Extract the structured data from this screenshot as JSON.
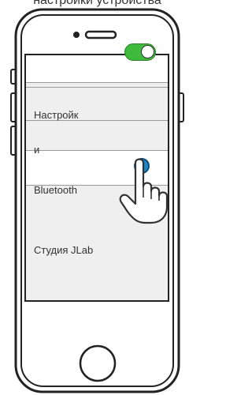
{
  "caption": {
    "text": "настройки устройства"
  },
  "settings": {
    "label_line1": "Настройк",
    "label_line2": "и",
    "bluetooth_label": "Bluetooth",
    "studio_label": "Студия JLab",
    "toggle_state": "on"
  },
  "colors": {
    "toggle_on": "#3fba3c",
    "touch_dot": "#1a88c8"
  },
  "icons": {
    "pointer": "hand-pointer-icon"
  }
}
